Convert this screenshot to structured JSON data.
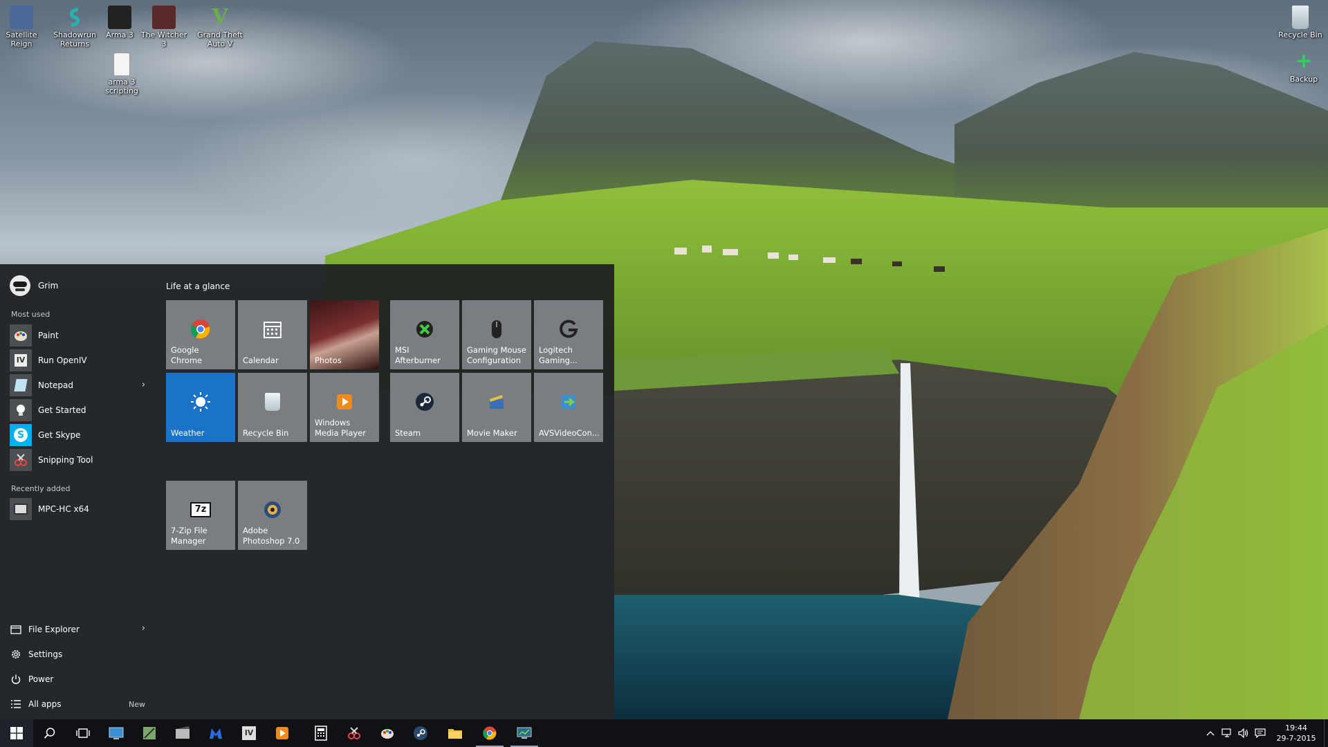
{
  "desktop": {
    "icons": [
      {
        "label": "Satellite Reign",
        "icon": "satellite-reign-icon",
        "color": "#4a6a9a"
      },
      {
        "label": "Shadowrun Returns",
        "icon": "shadowrun-icon",
        "color": "#2a7a7a"
      },
      {
        "label": "Arma 3",
        "icon": "arma3-icon",
        "color": "#222222"
      },
      {
        "label": "The Witcher 3",
        "icon": "witcher-icon",
        "color": "#5a2a2a"
      },
      {
        "label": "Grand Theft Auto V",
        "icon": "gta-icon",
        "color": "#3a6a3a"
      },
      {
        "label": "arma 3 scripting",
        "icon": "text-file-icon",
        "color": "#f0f0f0"
      },
      {
        "label": "Recycle Bin",
        "icon": "recycle-bin-icon",
        "color": "#c9d6de"
      },
      {
        "label": "Backup",
        "icon": "backup-icon",
        "color": "#2d9e4f"
      }
    ]
  },
  "start": {
    "user_name": "Grim",
    "most_used_label": "Most used",
    "most_used": [
      {
        "label": "Paint",
        "icon": "paint-icon",
        "bg": "#4b4f54",
        "has_arrow": false
      },
      {
        "label": "Run OpenIV",
        "icon": "openiv-icon",
        "bg": "#4b4f54",
        "has_arrow": false
      },
      {
        "label": "Notepad",
        "icon": "notepad-icon",
        "bg": "#4b4f54",
        "has_arrow": true
      },
      {
        "label": "Get Started",
        "icon": "lightbulb-icon",
        "bg": "#4b4f54",
        "has_arrow": false
      },
      {
        "label": "Get Skype",
        "icon": "skype-icon",
        "bg": "#00aff0",
        "has_arrow": false
      },
      {
        "label": "Snipping Tool",
        "icon": "scissors-icon",
        "bg": "#4b4f54",
        "has_arrow": false
      }
    ],
    "recently_added_label": "Recently added",
    "recently_added": [
      {
        "label": "MPC-HC x64",
        "icon": "mpc-hc-icon",
        "bg": "#4b4f54"
      }
    ],
    "bottom": {
      "file_explorer": "File Explorer",
      "settings": "Settings",
      "power": "Power",
      "all_apps": "All apps",
      "new_badge": "New"
    },
    "group_title": "Life at a glance",
    "tiles": [
      {
        "label": "Google Chrome",
        "icon": "chrome-icon"
      },
      {
        "label": "Calendar",
        "icon": "calendar-icon"
      },
      {
        "label": "Photos",
        "icon": "photos-icon"
      },
      {
        "label": "MSI Afterburner",
        "icon": "msi-afterburner-icon"
      },
      {
        "label": "Gaming Mouse Configuration",
        "icon": "mouse-icon"
      },
      {
        "label": "Logitech Gaming...",
        "icon": "logitech-icon"
      },
      {
        "label": "Weather",
        "icon": "sun-icon"
      },
      {
        "label": "Recycle Bin",
        "icon": "recycle-bin-icon"
      },
      {
        "label": "Windows Media Player",
        "icon": "media-player-icon"
      },
      {
        "label": "Steam",
        "icon": "steam-icon"
      },
      {
        "label": "Movie Maker",
        "icon": "movie-maker-icon"
      },
      {
        "label": "AVSVideoCon...",
        "icon": "avs-video-icon"
      },
      {
        "label": "7-Zip File Manager",
        "icon": "seven-zip-icon"
      },
      {
        "label": "Adobe Photoshop 7.0",
        "icon": "photoshop-icon"
      }
    ]
  },
  "taskbar": {
    "pinned": [
      {
        "name": "search-button",
        "icon": "search-icon"
      },
      {
        "name": "task-view-button",
        "icon": "task-view-icon"
      },
      {
        "name": "taskbar-remote-desktop",
        "icon": "remote-desktop-icon"
      },
      {
        "name": "taskbar-map-tool",
        "icon": "map-tool-icon"
      },
      {
        "name": "taskbar-film-editor",
        "icon": "film-editor-icon"
      },
      {
        "name": "taskbar-malwarebytes",
        "icon": "malwarebytes-icon"
      },
      {
        "name": "taskbar-openiv",
        "icon": "openiv-icon"
      },
      {
        "name": "taskbar-media-player",
        "icon": "media-player-icon"
      },
      {
        "name": "taskbar-calculator",
        "icon": "calculator-icon"
      },
      {
        "name": "taskbar-snipping-tool",
        "icon": "scissors-icon"
      },
      {
        "name": "taskbar-paint",
        "icon": "paint-icon"
      },
      {
        "name": "taskbar-steam",
        "icon": "steam-icon"
      },
      {
        "name": "taskbar-file-explorer",
        "icon": "folder-icon"
      },
      {
        "name": "taskbar-chrome",
        "icon": "chrome-icon"
      },
      {
        "name": "taskbar-monitor-app",
        "icon": "monitor-icon"
      }
    ],
    "clock": {
      "time": "19:44",
      "date": "29-7-2015"
    },
    "colors": {
      "accent": "#1a73c8",
      "tile": "#7a7e82"
    }
  }
}
